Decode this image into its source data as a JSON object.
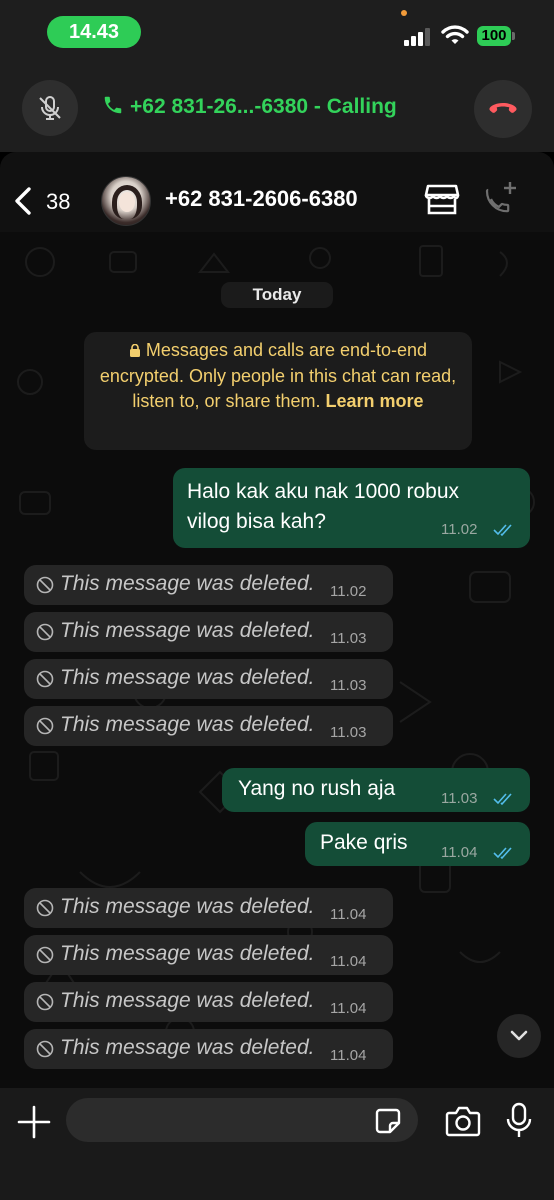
{
  "status_bar": {
    "time": "14.43",
    "battery": "100"
  },
  "call": {
    "label": "+62 831-26...-6380 - Calling"
  },
  "header": {
    "back_count": "38",
    "title": "+62 831-2606-6380"
  },
  "chat": {
    "date": "Today",
    "encryption": {
      "text": "Messages and calls are end-to-end encrypted. Only people in this chat can read, listen to, or share them.",
      "link": "Learn more"
    },
    "messages": [
      {
        "dir": "out",
        "line1": "Halo kak aku nak 1000 robux",
        "line2": "vilog bisa kah?",
        "time": "11.02"
      },
      {
        "dir": "in",
        "text": "This message was deleted.",
        "time": "11.02"
      },
      {
        "dir": "in",
        "text": "This message was deleted.",
        "time": "11.03"
      },
      {
        "dir": "in",
        "text": "This message was deleted.",
        "time": "11.03"
      },
      {
        "dir": "in",
        "text": "This message was deleted.",
        "time": "11.03"
      },
      {
        "dir": "out",
        "text": "Yang no rush aja",
        "time": "11.03"
      },
      {
        "dir": "out",
        "text": "Pake qris",
        "time": "11.04"
      },
      {
        "dir": "in",
        "text": "This message was deleted.",
        "time": "11.04"
      },
      {
        "dir": "in",
        "text": "This message was deleted.",
        "time": "11.04"
      },
      {
        "dir": "in",
        "text": "This message was deleted.",
        "time": "11.04"
      },
      {
        "dir": "in",
        "text": "This message was deleted.",
        "time": "11.04"
      }
    ]
  },
  "composer": {
    "placeholder": ""
  },
  "colors": {
    "accent_green": "#33d35b",
    "outgoing_bubble": "#144d37",
    "incoming_bubble": "#262626",
    "encryption_text": "#f3cf6e",
    "read_ticks": "#53bdeb"
  },
  "icons": [
    "mic-off-icon",
    "phone-icon",
    "end-call-icon",
    "back-chevron-icon",
    "store-icon",
    "add-call-icon",
    "lock-icon",
    "deleted-icon",
    "double-check-icon",
    "chevron-down-icon",
    "plus-icon",
    "sticker-icon",
    "camera-icon",
    "mic-icon"
  ]
}
